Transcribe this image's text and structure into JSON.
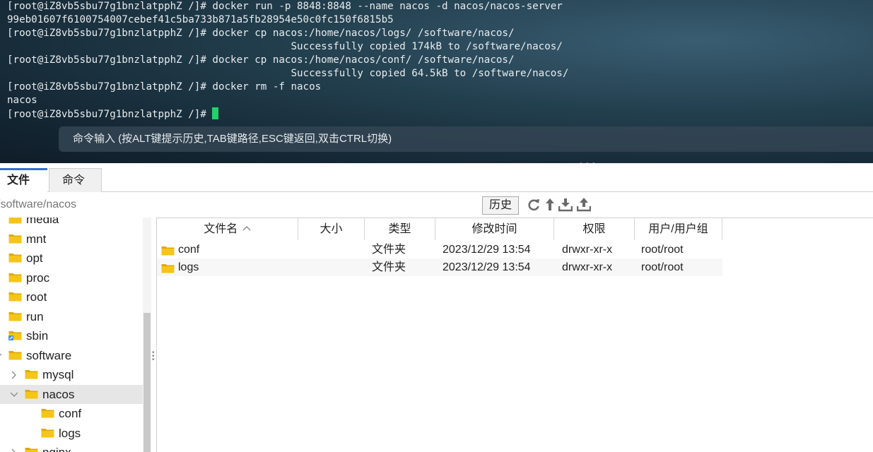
{
  "terminal": {
    "lines": [
      "[root@iZ8vb5sbu77g1bnzlatpphZ /]# docker run -p 8848:8848 --name nacos -d nacos/nacos-server",
      "99eb01607f6100754007cebef41c5ba733b871a5fb28954e50c0fc150f6815b5",
      "[root@iZ8vb5sbu77g1bnzlatpphZ /]# docker cp nacos:/home/nacos/logs/ /software/nacos/",
      "                                               Successfully copied 174kB to /software/nacos/",
      "[root@iZ8vb5sbu77g1bnzlatpphZ /]# docker cp nacos:/home/nacos/conf/ /software/nacos/",
      "                                               Successfully copied 64.5kB to /software/nacos/",
      "[root@iZ8vb5sbu77g1bnzlatpphZ /]# docker rm -f nacos",
      "nacos",
      "[root@iZ8vb5sbu77g1bnzlatpphZ /]# "
    ],
    "cursor_color": "#22d16b",
    "command_input_placeholder": "命令输入 (按ALT键提示历史,TAB键路径,ESC键返回,双击CTRL切换)"
  },
  "tabs": [
    {
      "label": "文件",
      "active": true
    },
    {
      "label": "命令",
      "active": false
    }
  ],
  "pathbar": {
    "path": "/software/nacos",
    "history_label": "历史",
    "tool_icons": [
      "refresh-icon",
      "up-arrow-icon",
      "download-icon",
      "upload-icon"
    ]
  },
  "tree": {
    "items": [
      {
        "label": "media",
        "level": 0,
        "expander": "none",
        "icon": "folder-icon"
      },
      {
        "label": "mnt",
        "level": 0,
        "expander": "none",
        "icon": "folder-icon"
      },
      {
        "label": "opt",
        "level": 0,
        "expander": "none",
        "icon": "folder-icon"
      },
      {
        "label": "proc",
        "level": 0,
        "expander": "none",
        "icon": "folder-icon"
      },
      {
        "label": "root",
        "level": 0,
        "expander": "collapsed",
        "icon": "folder-icon"
      },
      {
        "label": "run",
        "level": 0,
        "expander": "none",
        "icon": "folder-icon"
      },
      {
        "label": "sbin",
        "level": 0,
        "expander": "none",
        "icon": "link-folder-icon"
      },
      {
        "label": "software",
        "level": 0,
        "expander": "expanded",
        "icon": "folder-icon"
      },
      {
        "label": "mysql",
        "level": 1,
        "expander": "collapsed",
        "icon": "folder-icon"
      },
      {
        "label": "nacos",
        "level": 1,
        "expander": "expanded",
        "icon": "folder-icon",
        "selected": true
      },
      {
        "label": "conf",
        "level": 2,
        "expander": "none",
        "icon": "folder-icon"
      },
      {
        "label": "logs",
        "level": 2,
        "expander": "none",
        "icon": "folder-icon"
      },
      {
        "label": "nginx",
        "level": 1,
        "expander": "collapsed",
        "icon": "folder-icon"
      }
    ]
  },
  "filelist": {
    "columns": [
      {
        "label": "文件名",
        "sort": "ascending"
      },
      {
        "label": "大小"
      },
      {
        "label": "类型"
      },
      {
        "label": "修改时间"
      },
      {
        "label": "权限"
      },
      {
        "label": "用户/用户组"
      }
    ],
    "rows": [
      {
        "name": "conf",
        "size": "",
        "type": "文件夹",
        "modified": "2023/12/29 13:54",
        "permissions": "drwxr-xr-x",
        "owner": "root/root"
      },
      {
        "name": "logs",
        "size": "",
        "type": "文件夹",
        "modified": "2023/12/29 13:54",
        "permissions": "drwxr-xr-x",
        "owner": "root/root"
      }
    ]
  },
  "colors": {
    "folder": "#f5c518",
    "folder_dark": "#e0a800",
    "active_tab_accent": "#2f6fd6"
  }
}
